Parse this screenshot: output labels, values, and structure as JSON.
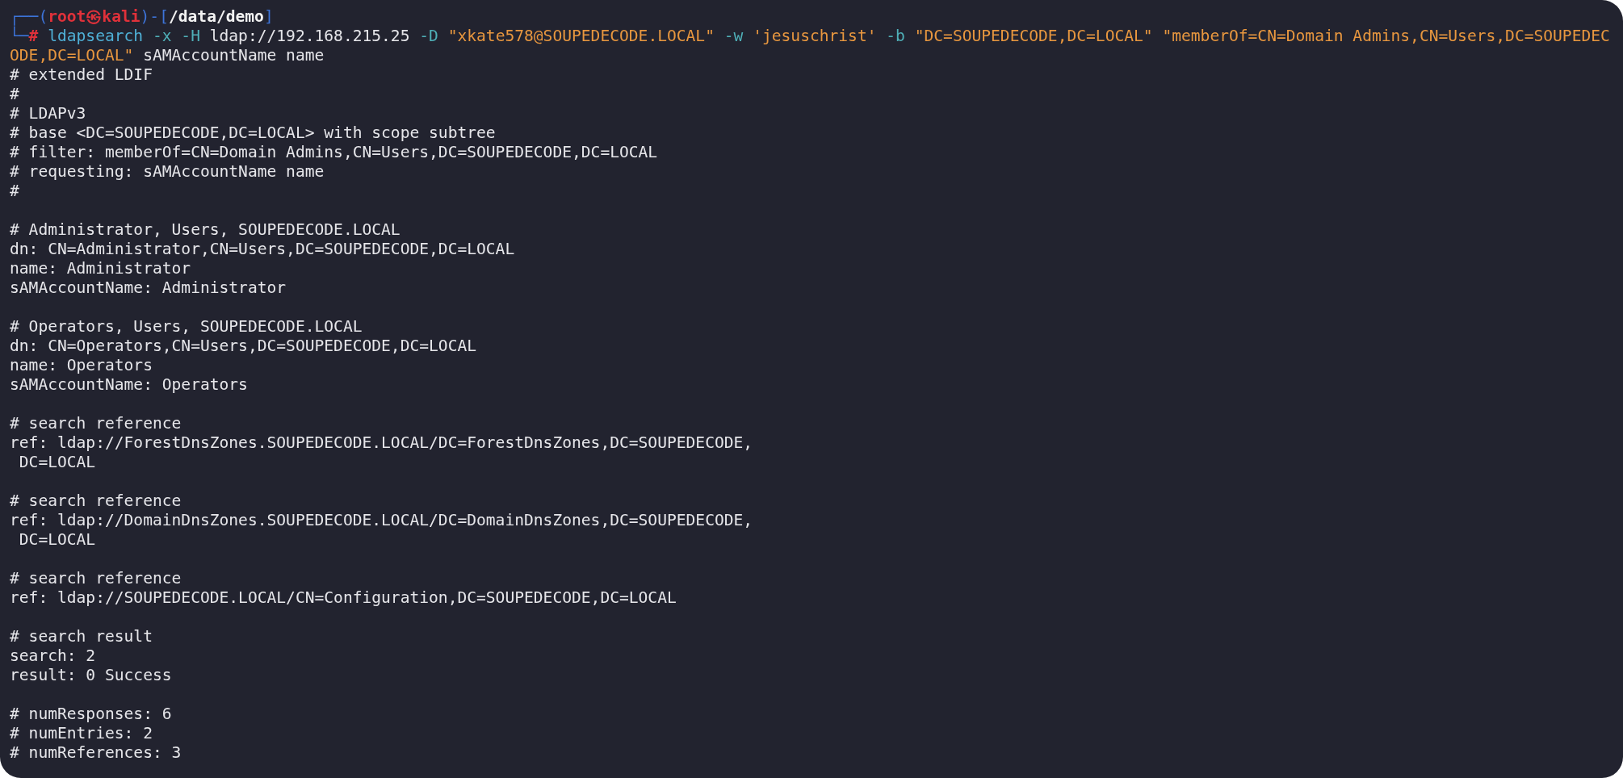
{
  "prompt": {
    "parts": [
      {
        "kind": "frame",
        "text": "┌──("
      },
      {
        "kind": "user",
        "text": "root㉿kali"
      },
      {
        "kind": "frame",
        "text": ")-["
      },
      {
        "kind": "path",
        "text": "/data/demo"
      },
      {
        "kind": "frame",
        "text": "]"
      }
    ]
  },
  "command": {
    "parts": [
      {
        "kind": "frame",
        "text": "└─"
      },
      {
        "kind": "mark",
        "text": "# "
      },
      {
        "kind": "cmd",
        "text": "ldapsearch"
      },
      {
        "kind": "flag",
        "text": " -x -H"
      },
      {
        "kind": "plain",
        "text": " ldap://192.168.215.25"
      },
      {
        "kind": "flag",
        "text": " -D"
      },
      {
        "kind": "string",
        "text": " \"xkate578@SOUPEDECODE.LOCAL\""
      },
      {
        "kind": "flag",
        "text": " -w"
      },
      {
        "kind": "string",
        "text": " 'jesuschrist'"
      },
      {
        "kind": "flag",
        "text": " -b"
      },
      {
        "kind": "string",
        "text": " \"DC=SOUPEDECODE,DC=LOCAL\" \"memberOf=CN=Domain Admins,CN=Users,DC=SOUPEDECODE,DC=LOCAL\""
      },
      {
        "kind": "plain",
        "text": " sAMAccountName name"
      }
    ]
  },
  "output_blocks": [
    [
      "# extended LDIF",
      "#",
      "# LDAPv3",
      "# base <DC=SOUPEDECODE,DC=LOCAL> with scope subtree",
      "# filter: memberOf=CN=Domain Admins,CN=Users,DC=SOUPEDECODE,DC=LOCAL",
      "# requesting: sAMAccountName name",
      "#"
    ],
    [
      "# Administrator, Users, SOUPEDECODE.LOCAL",
      "dn: CN=Administrator,CN=Users,DC=SOUPEDECODE,DC=LOCAL",
      "name: Administrator",
      "sAMAccountName: Administrator"
    ],
    [
      "# Operators, Users, SOUPEDECODE.LOCAL",
      "dn: CN=Operators,CN=Users,DC=SOUPEDECODE,DC=LOCAL",
      "name: Operators",
      "sAMAccountName: Operators"
    ],
    [
      "# search reference",
      "ref: ldap://ForestDnsZones.SOUPEDECODE.LOCAL/DC=ForestDnsZones,DC=SOUPEDECODE,",
      " DC=LOCAL"
    ],
    [
      "# search reference",
      "ref: ldap://DomainDnsZones.SOUPEDECODE.LOCAL/DC=DomainDnsZones,DC=SOUPEDECODE,",
      " DC=LOCAL"
    ],
    [
      "# search reference",
      "ref: ldap://SOUPEDECODE.LOCAL/CN=Configuration,DC=SOUPEDECODE,DC=LOCAL"
    ],
    [
      "# search result",
      "search: 2",
      "result: 0 Success"
    ],
    [
      "# numResponses: 6",
      "# numEntries: 2",
      "# numReferences: 3"
    ]
  ]
}
